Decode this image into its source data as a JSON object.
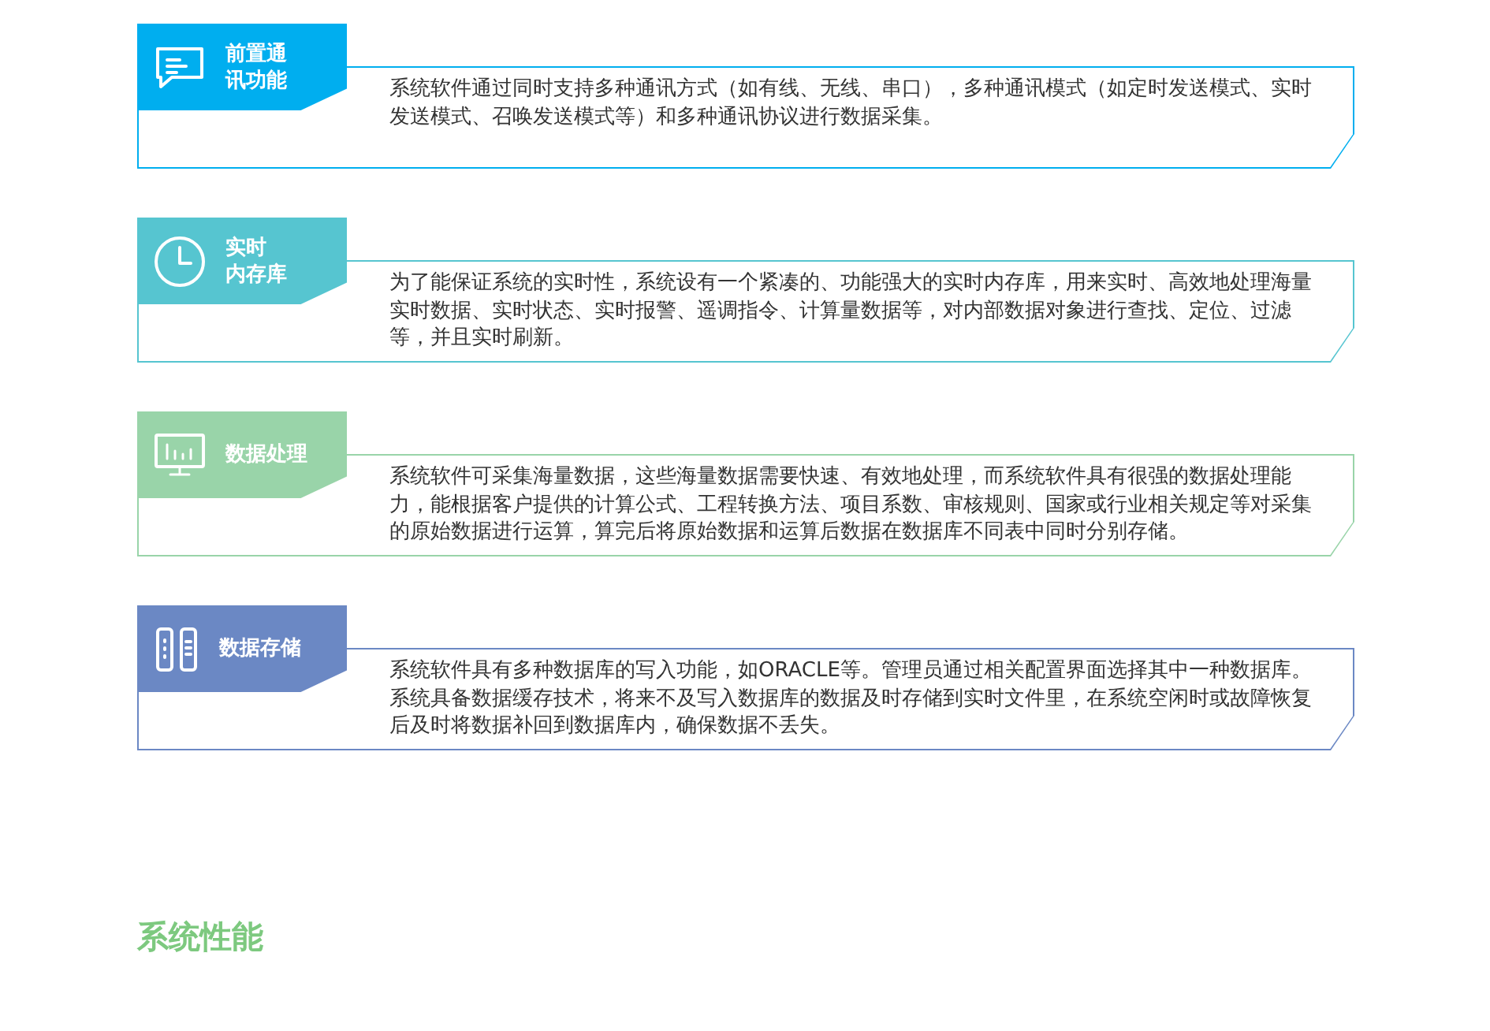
{
  "sections": [
    {
      "kind": "chat",
      "color": "#00aeef",
      "title_lines": [
        "前置通",
        "讯功能"
      ],
      "description": "系统软件通过同时支持多种通讯方式（如有线、无线、串口），多种通讯模式（如定时发送模式、实时发送模式、召唤发送模式等）和多种通讯协议进行数据采集。"
    },
    {
      "kind": "clock",
      "color": "#56c5d0",
      "title_lines": [
        "实时",
        "内存库"
      ],
      "description": "为了能保证系统的实时性，系统设有一个紧凑的、功能强大的实时内存库，用来实时、高效地处理海量实时数据、实时状态、实时报警、遥调指令、计算量数据等，对内部数据对象进行查找、定位、过滤等，并且实时刷新。"
    },
    {
      "kind": "monitor",
      "color": "#99d4a9",
      "title_lines": [
        "数据处理"
      ],
      "description": "系统软件可采集海量数据，这些海量数据需要快速、有效地处理，而系统软件具有很强的数据处理能力，能根据客户提供的计算公式、工程转换方法、项目系数、审核规则、国家或行业相关规定等对采集的原始数据进行运算，算完后将原始数据和运算后数据在数据库不同表中同时分别存储。"
    },
    {
      "kind": "storage",
      "color": "#6b88c4",
      "title_lines": [
        "数据存储"
      ],
      "description": "系统软件具有多种数据库的写入功能，如ORACLE等。管理员通过相关配置界面选择其中一种数据库。系统具备数据缓存技术，将来不及写入数据库的数据及时存储到实时文件里，在系统空闲时或故障恢复后及时将数据补回到数据库内，确保数据不丢失。"
    }
  ],
  "heading": "系统性能"
}
